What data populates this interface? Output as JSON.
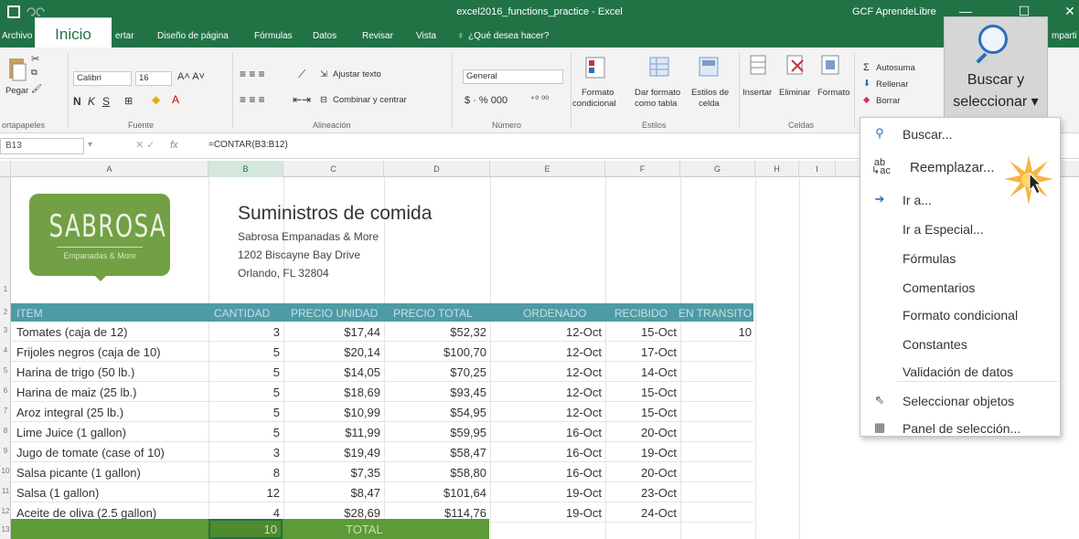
{
  "titlebar": {
    "title": "excel2016_functions_practice - Excel",
    "account": "GCF AprendeLibre",
    "minimize": "—",
    "maximize": "☐",
    "close": "✕"
  },
  "tabs": {
    "archivo": "Archivo",
    "inicio": "Inicio",
    "insertar": "ertar",
    "diseno": "Diseño de página",
    "formulas": "Fórmulas",
    "datos": "Datos",
    "revisar": "Revisar",
    "vista": "Vista",
    "tell_me": "¿Qué desea hacer?",
    "share": "mparti"
  },
  "ribbon": {
    "paste": "Pegar",
    "clipboard": "ortapapeles",
    "font_name": "Calibri",
    "font_size": "16",
    "font_group": "Fuente",
    "wrap": "Ajustar texto",
    "merge": "Combinar y centrar",
    "align_group": "Alineación",
    "number_format": "General",
    "number_group": "Número",
    "cond_format_1": "Formato",
    "cond_format_2": "condicional",
    "format_table_1": "Dar formato",
    "format_table_2": "como tabla",
    "cell_styles_1": "Estilos de",
    "cell_styles_2": "celda",
    "styles_group": "Estilos",
    "insert": "Insertar",
    "delete": "Eliminar",
    "format": "Formato",
    "cells_group": "Celdas",
    "autosum": "Autosuma",
    "fill": "Rellenar",
    "clear": "Borrar",
    "find_select_1": "Buscar y",
    "find_select_2": "seleccionar ▾"
  },
  "formula_bar": {
    "name_box": "B13",
    "fx": "fx",
    "formula": "=CONTAR(B3:B12)"
  },
  "columns": [
    "A",
    "B",
    "C",
    "D",
    "E",
    "F",
    "G",
    "H",
    "I"
  ],
  "rows": [
    "1",
    "2",
    "3",
    "4",
    "5",
    "6",
    "7",
    "8",
    "9",
    "10",
    "11",
    "12",
    "13"
  ],
  "logo": {
    "name": "SABROSA",
    "tagline": "Empanadas & More"
  },
  "company": {
    "title": "Suministros de comida",
    "line1": "Sabrosa Empanadas & More",
    "line2": "1202 Biscayne Bay Drive",
    "line3": "Orlando, FL 32804"
  },
  "table": {
    "headers": [
      "ITEM",
      "CANTIDAD",
      "PRECIO UNIDAD",
      "PRECIO TOTAL",
      "ORDENADO",
      "RECIBIDO",
      "EN TRANSITO"
    ],
    "rows": [
      [
        "Tomates (caja de 12)",
        "3",
        "$17,44",
        "$52,32",
        "12-Oct",
        "15-Oct",
        "10"
      ],
      [
        "Frijoles negros (caja de 10)",
        "5",
        "$20,14",
        "$100,70",
        "12-Oct",
        "17-Oct",
        ""
      ],
      [
        "Harina de trigo (50 lb.)",
        "5",
        "$14,05",
        "$70,25",
        "12-Oct",
        "14-Oct",
        ""
      ],
      [
        "Harina de maiz (25 lb.)",
        "5",
        "$18,69",
        "$93,45",
        "12-Oct",
        "15-Oct",
        ""
      ],
      [
        "Aroz integral (25 lb.)",
        "5",
        "$10,99",
        "$54,95",
        "12-Oct",
        "15-Oct",
        ""
      ],
      [
        "Lime Juice (1 gallon)",
        "5",
        "$11,99",
        "$59,95",
        "16-Oct",
        "20-Oct",
        ""
      ],
      [
        "Jugo de tomate (case of 10)",
        "3",
        "$19,49",
        "$58,47",
        "16-Oct",
        "19-Oct",
        ""
      ],
      [
        "Salsa picante (1 gallon)",
        "8",
        "$7,35",
        "$58,80",
        "16-Oct",
        "20-Oct",
        ""
      ],
      [
        "Salsa (1 gallon)",
        "12",
        "$8,47",
        "$101,64",
        "19-Oct",
        "23-Oct",
        ""
      ],
      [
        "Aceite de oliva (2.5 gallon)",
        "4",
        "$28,69",
        "$114,76",
        "19-Oct",
        "24-Oct",
        ""
      ]
    ],
    "total_count": "10",
    "total_label": "TOTAL"
  },
  "menu": {
    "items": [
      {
        "label": "Buscar...",
        "icon": "search-icon"
      },
      {
        "label": "Reemplazar...",
        "icon": "replace-icon"
      },
      {
        "label": "Ir a...",
        "icon": "arrow-right-icon"
      },
      {
        "label": "Ir a Especial...",
        "icon": ""
      },
      {
        "label": "Fórmulas",
        "icon": ""
      },
      {
        "label": "Comentarios",
        "icon": ""
      },
      {
        "label": "Formato condicional",
        "icon": ""
      },
      {
        "label": "Constantes",
        "icon": ""
      },
      {
        "label": "Validación de datos",
        "icon": ""
      },
      {
        "label": "Seleccionar objetos",
        "icon": "cursor-icon"
      },
      {
        "label": "Panel de selección...",
        "icon": "selection-pane-icon"
      }
    ]
  },
  "colors": {
    "excel_green": "#217346",
    "header_teal": "#4e9ba5",
    "logo_green": "#72a045",
    "accent_blue": "#2a6ebb"
  }
}
